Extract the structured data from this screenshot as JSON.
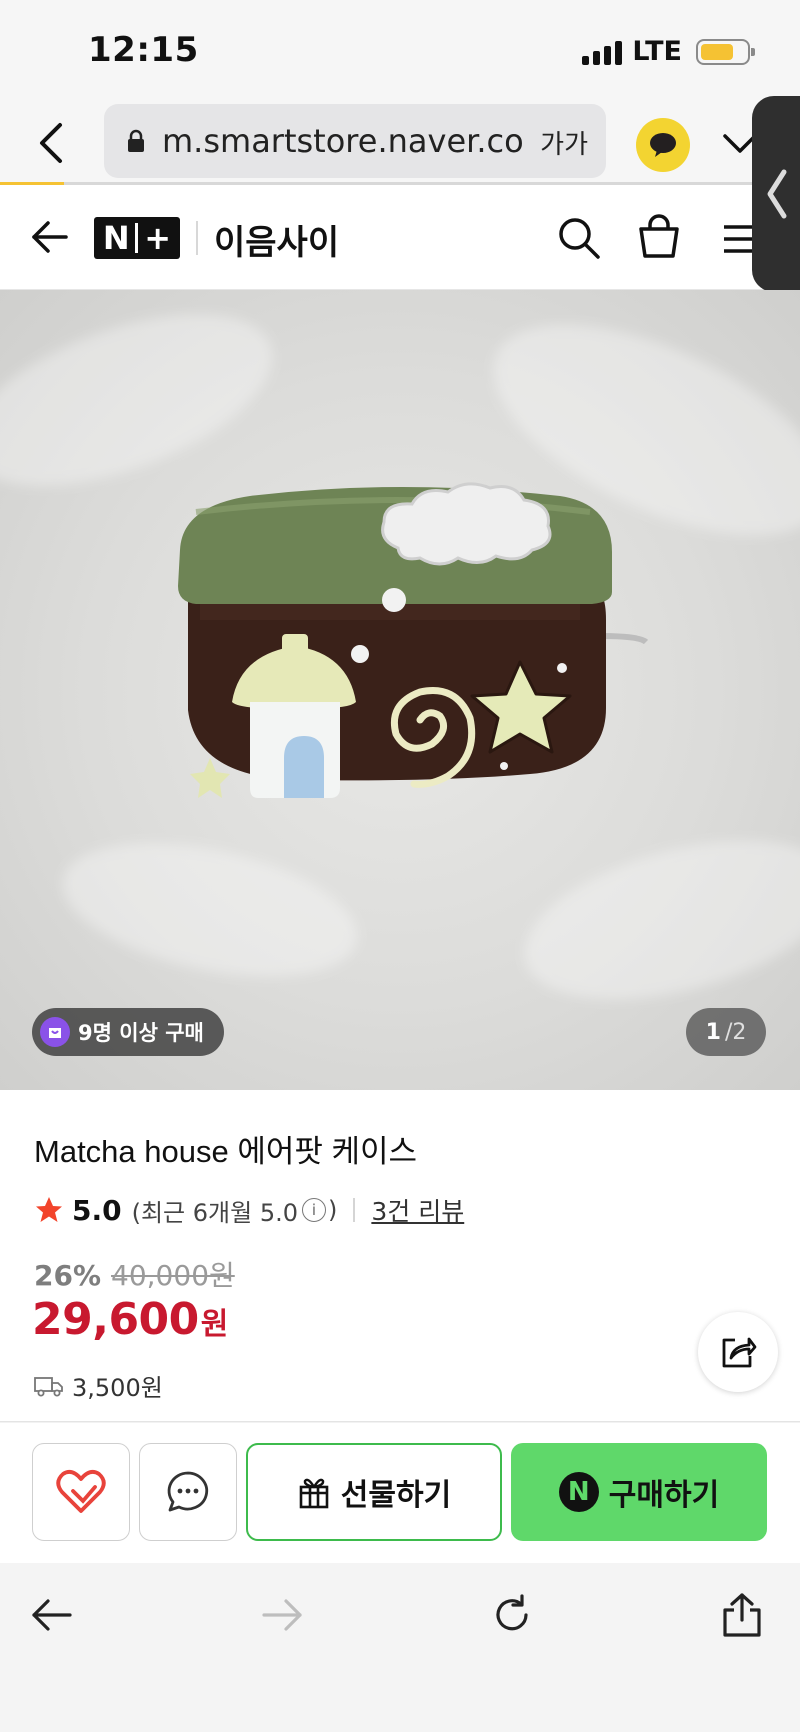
{
  "status_bar": {
    "time": "12:15",
    "network": "LTE"
  },
  "browser": {
    "url": "m.smartstore.naver.com",
    "text_size_label": "가가",
    "progress": 0.08
  },
  "store": {
    "logo_text": "N+",
    "name": "이음사이"
  },
  "gallery": {
    "buyer_badge": "9명 이상 구매",
    "current_page": "1",
    "total_pages": "/2"
  },
  "product": {
    "title": "Matcha house 에어팟 케이스",
    "rating": "5.0",
    "rating_recent": "(최근 6개월 5.0",
    "rating_recent_close": ")",
    "review_link": "3건 리뷰",
    "discount_rate": "26%",
    "original_price": "40,000원",
    "price": "29,600",
    "price_unit": "원",
    "shipping_fee": "3,500원"
  },
  "actions": {
    "gift_label": "선물하기",
    "buy_label": "구매하기",
    "npay_letter": "N"
  },
  "colors": {
    "accent_yellow": "#f5c233",
    "price_red": "#c8192f",
    "buy_green": "#5fd86a",
    "gift_border": "#3dbb4c",
    "like_red": "#e8433b",
    "badge_purple": "#8a52e8"
  },
  "icons": [
    "back-icon",
    "lock-icon",
    "kakaotalk-icon",
    "chevron-down-icon",
    "arrow-left-icon",
    "search-icon",
    "cart-icon",
    "menu-icon",
    "bag-icon",
    "star-icon",
    "info-icon",
    "truck-icon",
    "share-icon",
    "heart-icon",
    "chat-icon",
    "gift-icon",
    "forward-icon",
    "reload-icon",
    "upload-icon"
  ]
}
